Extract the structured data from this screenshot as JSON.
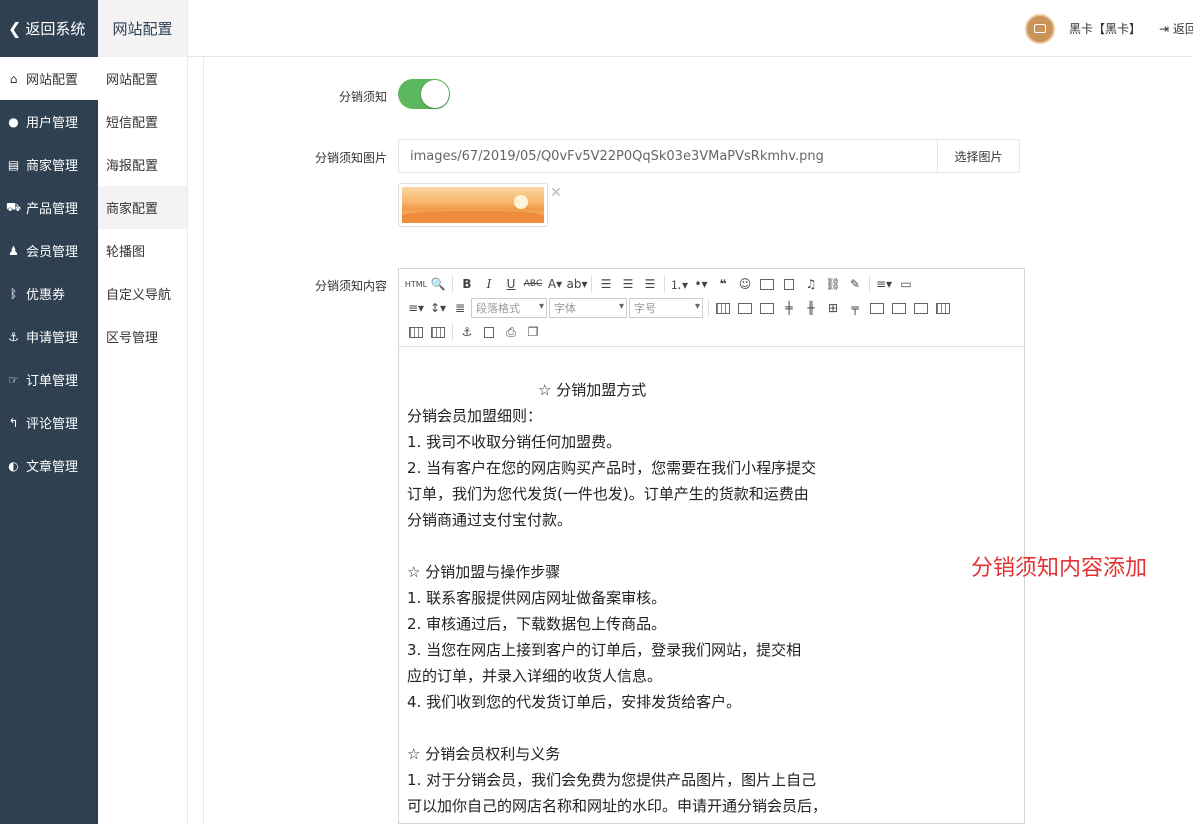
{
  "topbar": {
    "back_label": "返回系统",
    "title": "网站配置",
    "user_name": "黑卡【黑卡】",
    "logout_label": "返回"
  },
  "sidebar": {
    "items": [
      {
        "icon": "home-icon",
        "label": "网站配置"
      },
      {
        "icon": "user-icon",
        "label": "用户管理"
      },
      {
        "icon": "server-icon",
        "label": "商家管理"
      },
      {
        "icon": "cart-icon",
        "label": "产品管理"
      },
      {
        "icon": "group-icon",
        "label": "会员管理"
      },
      {
        "icon": "ticket-icon",
        "label": "优惠券"
      },
      {
        "icon": "anchor-icon",
        "label": "申请管理"
      },
      {
        "icon": "hand-icon",
        "label": "订单管理"
      },
      {
        "icon": "reply-icon",
        "label": "评论管理"
      },
      {
        "icon": "contrast-icon",
        "label": "文章管理"
      }
    ]
  },
  "subnav": {
    "items": [
      "网站配置",
      "短信配置",
      "海报配置",
      "商家配置",
      "轮播图",
      "自定义导航",
      "区号管理"
    ]
  },
  "form": {
    "toggle_label": "分销须知",
    "toggle_on": true,
    "image_label": "分销须知图片",
    "image_value": "images/67/2019/05/Q0vFv5V22P0QqSk03e3VMaPVsRkmhv.png",
    "image_button": "选择图片",
    "content_label": "分销须知内容"
  },
  "editor": {
    "paragraph_placeholder": "段落格式",
    "font_placeholder": "字体",
    "size_placeholder": "字号",
    "lines": [
      "☆ 分销加盟方式",
      "分销会员加盟细则：",
      "1. 我司不收取分销任何加盟费。",
      "2. 当有客户在您的网店购买产品时，您需要在我们小程序提交",
      "订单，我们为您代发货(一件也发)。订单产生的货款和运费由",
      "分销商通过支付宝付款。",
      "",
      "☆ 分销加盟与操作步骤",
      "1. 联系客服提供网店网址做备案审核。",
      "2. 审核通过后，下载数据包上传商品。",
      "3. 当您在网店上接到客户的订单后，登录我们网站，提交相",
      "应的订单，并录入详细的收货人信息。",
      "4. 我们收到您的代发货订单后，安排发货给客户。",
      "",
      "☆ 分销会员权利与义务",
      "1. 对于分销会员，我们会免费为您提供产品图片，图片上自己",
      "可以加你自己的网店名称和网址的水印。申请开通分销会员后，"
    ]
  },
  "annotation": "分销须知内容添加",
  "colors": {
    "sidebar_bg": "#2f4050",
    "toggle_on": "#5cb85c",
    "annotation": "#e53333"
  }
}
